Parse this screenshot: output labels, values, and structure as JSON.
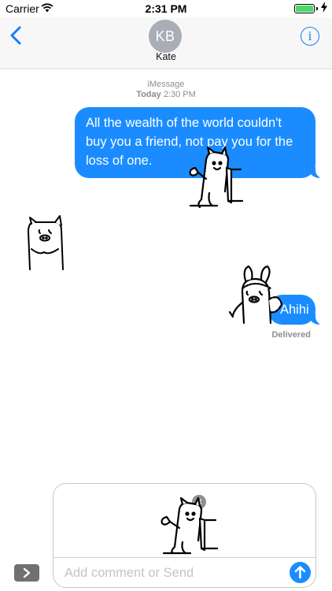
{
  "status_bar": {
    "carrier": "Carrier",
    "time": "2:31 PM",
    "battery_level": 1.0,
    "battery_color": "#4cd964",
    "charging_icon": "bolt-icon"
  },
  "header": {
    "avatar_initials": "KB",
    "contact_name": "Kate",
    "back_icon": "chevron-left-icon",
    "info_icon": "info-icon",
    "info_label": "i",
    "accent_color": "#147efb"
  },
  "conversation": {
    "service": "iMessage",
    "day": "Today",
    "time": "2:30 PM",
    "messages": [
      {
        "from": "me",
        "text": "All the wealth of the world couldn't buy you a friend, not pay you for the loss of one."
      },
      {
        "from": "me",
        "text": "Ahihi"
      }
    ],
    "stickers": [
      {
        "name": "pig-typing-laptop-sticker"
      },
      {
        "name": "pig-standing-sticker"
      },
      {
        "name": "pig-bunny-hood-sticker"
      }
    ],
    "delivered_label": "Delivered",
    "bubble_color": "#1a8cff"
  },
  "compose": {
    "attached_sticker": "pig-typing-laptop-sticker",
    "remove_label": "×",
    "placeholder": "Add comment or Send",
    "send_icon": "arrow-up-icon",
    "apps_icon": "chevron-right-icon"
  }
}
